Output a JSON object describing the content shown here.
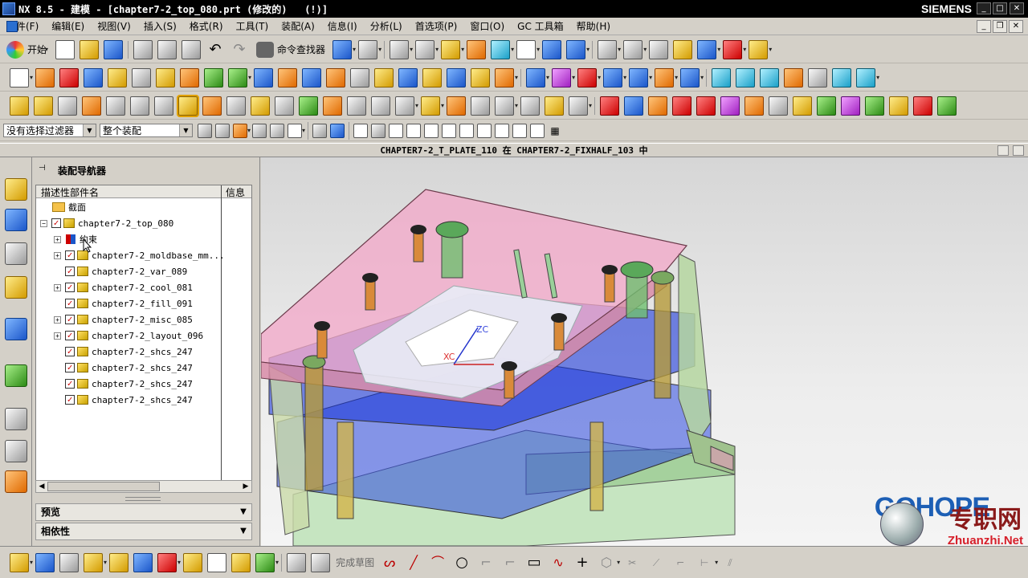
{
  "window": {
    "title": "NX 8.5 - 建模 - [chapter7-2_top_080.prt (修改的)   (!)]",
    "brand": "SIEMENS"
  },
  "menu": [
    "文件(F)",
    "编辑(E)",
    "视图(V)",
    "插入(S)",
    "格式(R)",
    "工具(T)",
    "装配(A)",
    "信息(I)",
    "分析(L)",
    "首选项(P)",
    "窗口(O)",
    "GC 工具箱",
    "帮助(H)"
  ],
  "toolbar": {
    "start_label": "开始",
    "command_finder_label": "命令查找器"
  },
  "selection": {
    "filter_value": "没有选择过滤器",
    "scope_value": "整个装配"
  },
  "status": {
    "work_part": "CHAPTER7-2_T_PLATE_110 在 CHAPTER7-2_FIXHALF_103 中"
  },
  "navigator": {
    "title": "装配导航器",
    "col_name": "描述性部件名",
    "col_info": "信息",
    "section_folder": "截面",
    "root": "chapter7-2_top_080",
    "constraints": "约束",
    "children": [
      {
        "name": "chapter7-2_moldbase_mm...",
        "expandable": true
      },
      {
        "name": "chapter7-2_var_089",
        "expandable": false
      },
      {
        "name": "chapter7-2_cool_081",
        "expandable": true
      },
      {
        "name": "chapter7-2_fill_091",
        "expandable": false
      },
      {
        "name": "chapter7-2_misc_085",
        "expandable": true
      },
      {
        "name": "chapter7-2_layout_096",
        "expandable": true
      },
      {
        "name": "chapter7-2_shcs_247",
        "expandable": false
      },
      {
        "name": "chapter7-2_shcs_247",
        "expandable": false
      },
      {
        "name": "chapter7-2_shcs_247",
        "expandable": false
      },
      {
        "name": "chapter7-2_shcs_247",
        "expandable": false
      }
    ],
    "preview_label": "预览",
    "dependency_label": "相依性"
  },
  "viewport": {
    "axis_zc": "ZC",
    "axis_xc": "XC",
    "watermark_gohope": "GOHOPE",
    "watermark_cn": "专职网",
    "watermark_url": "Zhuanzhi.Net"
  },
  "bottombar": {
    "finish_sketch_label": "完成草图"
  },
  "colors": {
    "plate_pink": "#e89cc0",
    "plate_blue": "#2f4fe0",
    "plate_green": "#a8d8a0",
    "logo_blue": "#1d5fb5"
  }
}
